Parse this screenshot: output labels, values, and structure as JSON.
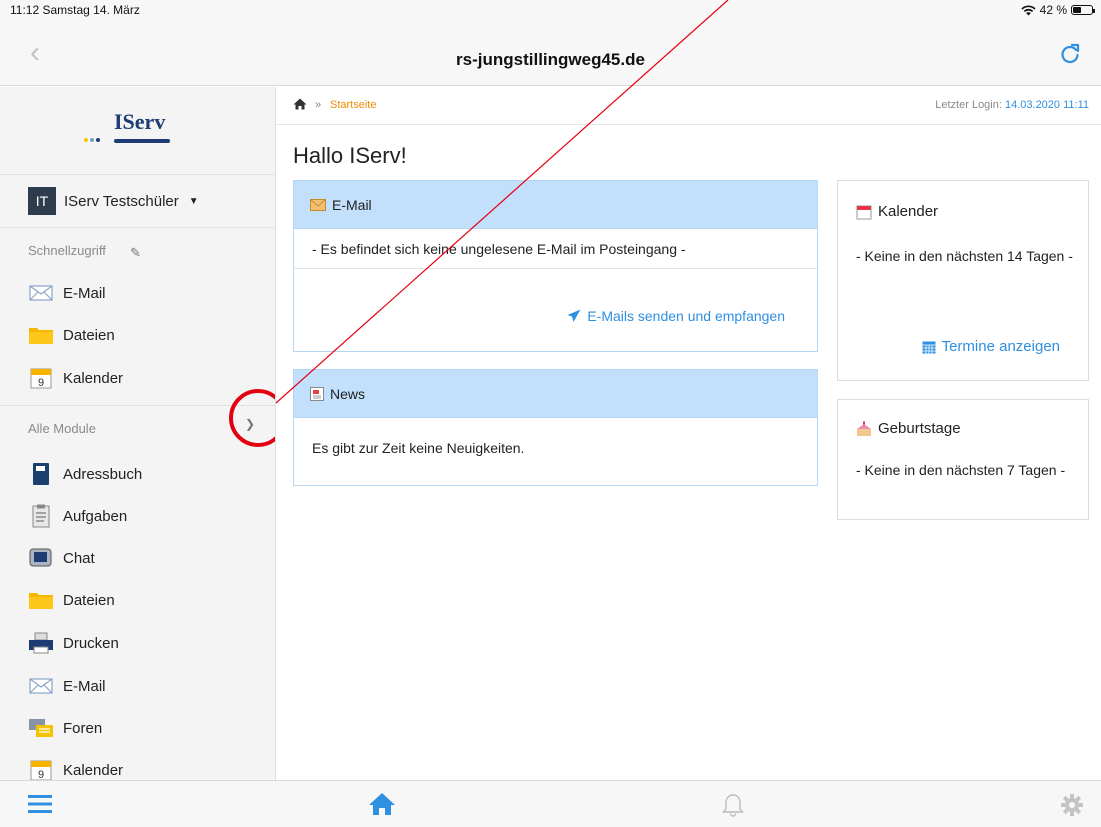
{
  "status_bar": {
    "time_date": "11:12  Samstag 14. März",
    "battery": "42 %",
    "battery_level": 0.42
  },
  "browser": {
    "url_title": "rs-jungstillingweg45.de"
  },
  "sidebar": {
    "logo_text": "IServ",
    "user_initials": "IT",
    "user_name": "IServ Testschüler",
    "quick_access_label": "Schnellzugriff",
    "quick_items": [
      {
        "label": "E-Mail",
        "icon": "envelope-icon"
      },
      {
        "label": "Dateien",
        "icon": "folder-icon"
      },
      {
        "label": "Kalender",
        "icon": "calendar-icon"
      }
    ],
    "all_modules_label": "Alle Module",
    "modules": [
      {
        "label": "Adressbuch",
        "icon": "address-book-icon"
      },
      {
        "label": "Aufgaben",
        "icon": "clipboard-icon"
      },
      {
        "label": "Chat",
        "icon": "chat-icon"
      },
      {
        "label": "Dateien",
        "icon": "folder-icon"
      },
      {
        "label": "Drucken",
        "icon": "printer-icon"
      },
      {
        "label": "E-Mail",
        "icon": "envelope-icon"
      },
      {
        "label": "Foren",
        "icon": "forum-icon"
      },
      {
        "label": "Kalender",
        "icon": "calendar-icon"
      }
    ]
  },
  "breadcrumb": {
    "current": "Startseite",
    "last_login_label": "Letzter Login:",
    "last_login_value": "14.03.2020 11:11"
  },
  "main": {
    "greeting": "Hallo IServ!",
    "email_panel": {
      "title": "E-Mail",
      "message": "- Es befindet sich keine ungelesene E-Mail im Posteingang -",
      "action": "E-Mails senden und empfangen"
    },
    "news_panel": {
      "title": "News",
      "message": "Es gibt zur Zeit keine Neuigkeiten."
    },
    "calendar_panel": {
      "title": "Kalender",
      "message": "- Keine in den nächsten 14 Tagen -",
      "action": "Termine anzeigen"
    },
    "birthday_panel": {
      "title": "Geburtstage",
      "message": "- Keine in den nächsten 7 Tagen -"
    }
  },
  "colors": {
    "accent": "#2f8fe0",
    "breadcrumb": "#f18c00",
    "panel_head": "#c2dffb",
    "annotation": "#e3000f",
    "navy": "#1c3c73"
  }
}
